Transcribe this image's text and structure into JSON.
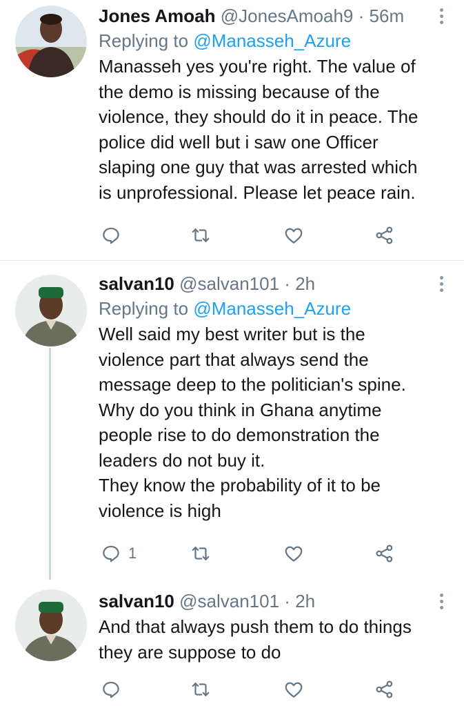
{
  "tweets": [
    {
      "name": "Jones Amoah",
      "handle": "@JonesAmoah9",
      "separator": "·",
      "time": "56m",
      "replying_prefix": "Replying to",
      "replying_to": "@Manasseh_Azure",
      "text": "Manasseh yes you're right. The value of\nthe demo is missing because of the\nviolence, they should do it in peace.  The\npolice did well but i saw one Officer\nslaping one guy that was arrested which\nis unprofessional. Please let peace rain.",
      "reply_count": ""
    },
    {
      "name": "salvan10",
      "handle": "@salvan101",
      "separator": "·",
      "time": "2h",
      "replying_prefix": "Replying to",
      "replying_to": "@Manasseh_Azure",
      "text": "Well said my best writer but is the\nviolence part that always send the\nmessage deep to the politician's  spine.\nWhy do you think in Ghana anytime\npeople rise to do demonstration the\nleaders do not buy it.\nThey know the probability of it to be\nviolence is high",
      "reply_count": "1"
    },
    {
      "name": "salvan10",
      "handle": "@salvan101",
      "separator": "·",
      "time": "2h",
      "text": "And that always push them to do things\nthey are suppose to do",
      "reply_count": ""
    }
  ],
  "icons": {
    "reply": "reply-icon",
    "retweet": "retweet-icon",
    "like": "like-icon",
    "share": "share-icon",
    "more": "more-vertical-icon"
  },
  "colors": {
    "name": "#14171a",
    "secondary": "#657786",
    "mention": "#1da1f2",
    "icon": "#657786",
    "divider": "#e1e8ed"
  }
}
